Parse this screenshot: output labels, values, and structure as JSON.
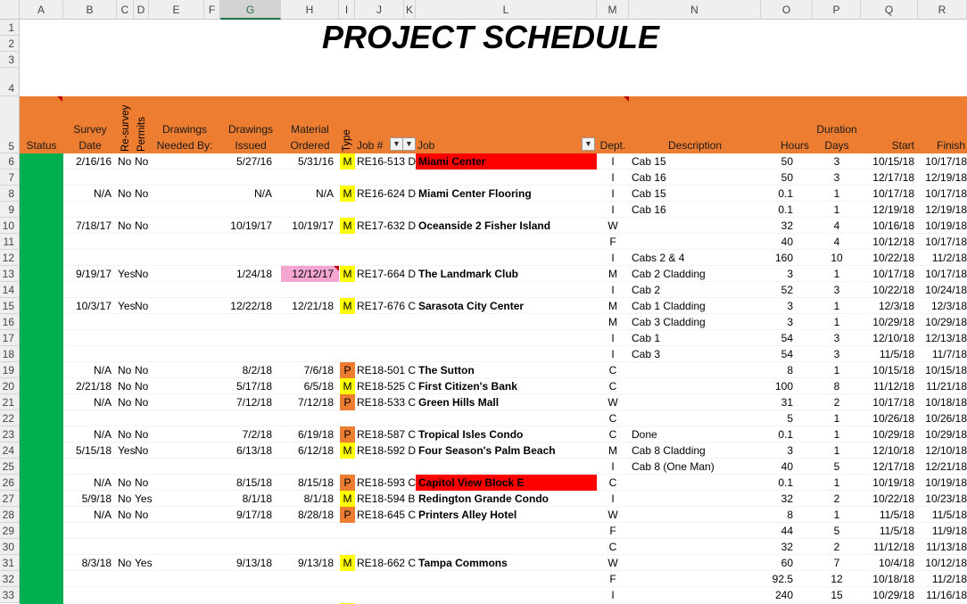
{
  "sheet": {
    "title": "PROJECT SCHEDULE",
    "columns": [
      "A",
      "B",
      "C",
      "D",
      "E",
      "F",
      "G",
      "H",
      "I",
      "J",
      "K",
      "L",
      "M",
      "N",
      "O",
      "P",
      "Q",
      "R"
    ],
    "selected_column": "G",
    "colors": {
      "header_orange": "#ed7d31",
      "status_green": "#00b050",
      "type_M": "#ffff00",
      "type_P": "#ed7d31",
      "job_highlight_red": "#ff0000",
      "material_highlight_pink": "#f4a6d0"
    },
    "headers": {
      "status": "Status",
      "survey": "Survey\nDate",
      "resurvey": "Re-survey",
      "permits": "Permits",
      "drawings_needed": "Drawings\nNeeded By:",
      "drawings_issued": "Drawings\nIssued",
      "material": "Material\nOrdered",
      "type": "Type",
      "jobnum": "Job #",
      "job": "Job",
      "dept": "Dept.",
      "description": "Description",
      "duration": "Duration",
      "hours": "Hours",
      "days": "Days",
      "start": "Start",
      "finish": "Finish"
    },
    "rows": [
      {
        "row": "6",
        "survey": "2/16/16",
        "resurvey": "No",
        "permits": "No",
        "issued": "5/27/16",
        "ordered": "5/31/16",
        "type": "M",
        "jobnum": "RE16-513 D",
        "job": "Miami Center",
        "job_red": true,
        "dept": "I",
        "desc": "Cab 15",
        "hours": "50",
        "days": "3",
        "start": "10/15/18",
        "finish": "10/17/18"
      },
      {
        "row": "7",
        "dept": "I",
        "desc": "Cab 16",
        "hours": "50",
        "days": "3",
        "start": "12/17/18",
        "finish": "12/19/18"
      },
      {
        "row": "8",
        "survey": "N/A",
        "resurvey": "No",
        "permits": "No",
        "issued": "N/A",
        "ordered": "N/A",
        "type": "M",
        "jobnum": "RE16-624 D",
        "job": "Miami Center Flooring",
        "dept": "I",
        "desc": "Cab 15",
        "hours": "0.1",
        "days": "1",
        "start": "10/17/18",
        "finish": "10/17/18"
      },
      {
        "row": "9",
        "dept": "I",
        "desc": "Cab 16",
        "hours": "0.1",
        "days": "1",
        "start": "12/19/18",
        "finish": "12/19/18"
      },
      {
        "row": "10",
        "survey": "7/18/17",
        "resurvey": "No",
        "permits": "No",
        "issued": "10/19/17",
        "ordered": "10/19/17",
        "type": "M",
        "jobnum": "RE17-632 D",
        "job": "Oceanside 2 Fisher Island",
        "dept": "W",
        "hours": "32",
        "days": "4",
        "start": "10/16/18",
        "finish": "10/19/18"
      },
      {
        "row": "11",
        "dept": "F",
        "hours": "40",
        "days": "4",
        "start": "10/12/18",
        "finish": "10/17/18"
      },
      {
        "row": "12",
        "dept": "I",
        "desc": "Cabs 2 & 4",
        "hours": "160",
        "days": "10",
        "start": "10/22/18",
        "finish": "11/2/18"
      },
      {
        "row": "13",
        "survey": "9/19/17",
        "resurvey": "Yes",
        "permits": "No",
        "issued": "1/24/18",
        "ordered": "12/12/17",
        "ordered_pink": true,
        "type": "M",
        "jobnum": "RE17-664 D",
        "job": "The Landmark Club",
        "dept": "M",
        "desc": "Cab 2 Cladding",
        "hours": "3",
        "days": "1",
        "start": "10/17/18",
        "finish": "10/17/18"
      },
      {
        "row": "14",
        "dept": "I",
        "desc": "Cab 2",
        "hours": "52",
        "days": "3",
        "start": "10/22/18",
        "finish": "10/24/18"
      },
      {
        "row": "15",
        "survey": "10/3/17",
        "resurvey": "Yes",
        "permits": "No",
        "issued": "12/22/18",
        "ordered": "12/21/18",
        "type": "M",
        "jobnum": "RE17-676 C",
        "job": "Sarasota City Center",
        "dept": "M",
        "desc": "Cab 1 Cladding",
        "hours": "3",
        "days": "1",
        "start": "12/3/18",
        "finish": "12/3/18"
      },
      {
        "row": "16",
        "dept": "M",
        "desc": "Cab 3 Cladding",
        "hours": "3",
        "days": "1",
        "start": "10/29/18",
        "finish": "10/29/18"
      },
      {
        "row": "17",
        "dept": "I",
        "desc": "Cab 1",
        "hours": "54",
        "days": "3",
        "start": "12/10/18",
        "finish": "12/13/18"
      },
      {
        "row": "18",
        "dept": "I",
        "desc": "Cab 3",
        "hours": "54",
        "days": "3",
        "start": "11/5/18",
        "finish": "11/7/18"
      },
      {
        "row": "19",
        "survey": "N/A",
        "resurvey": "No",
        "permits": "No",
        "issued": "8/2/18",
        "ordered": "7/6/18",
        "type": "P",
        "jobnum": "RE18-501 C",
        "job": "The Sutton",
        "dept": "C",
        "hours": "8",
        "days": "1",
        "start": "10/15/18",
        "finish": "10/15/18"
      },
      {
        "row": "20",
        "survey": "2/21/18",
        "resurvey": "No",
        "permits": "No",
        "issued": "5/17/18",
        "ordered": "6/5/18",
        "type": "M",
        "jobnum": "RE18-525 C",
        "job": "First Citizen's Bank",
        "dept": "C",
        "hours": "100",
        "days": "8",
        "start": "11/12/18",
        "finish": "11/21/18"
      },
      {
        "row": "21",
        "survey": "N/A",
        "resurvey": "No",
        "permits": "No",
        "issued": "7/12/18",
        "ordered": "7/12/18",
        "type": "P",
        "jobnum": "RE18-533 C",
        "job": "Green Hills Mall",
        "dept": "W",
        "hours": "31",
        "days": "2",
        "start": "10/17/18",
        "finish": "10/18/18"
      },
      {
        "row": "22",
        "dept": "C",
        "hours": "5",
        "days": "1",
        "start": "10/26/18",
        "finish": "10/26/18"
      },
      {
        "row": "23",
        "survey": "N/A",
        "resurvey": "No",
        "permits": "No",
        "issued": "7/2/18",
        "ordered": "6/19/18",
        "type": "P",
        "jobnum": "RE18-587 C",
        "job": "Tropical Isles Condo",
        "dept": "C",
        "desc": "Done",
        "hours": "0.1",
        "days": "1",
        "start": "10/29/18",
        "finish": "10/29/18"
      },
      {
        "row": "24",
        "survey": "5/15/18",
        "resurvey": "Yes",
        "permits": "No",
        "issued": "6/13/18",
        "ordered": "6/12/18",
        "type": "M",
        "jobnum": "RE18-592 D",
        "job": "Four Season's Palm Beach",
        "dept": "M",
        "desc": "Cab 8 Cladding",
        "hours": "3",
        "days": "1",
        "start": "12/10/18",
        "finish": "12/10/18"
      },
      {
        "row": "25",
        "dept": "I",
        "desc": "Cab 8 (One Man)",
        "hours": "40",
        "days": "5",
        "start": "12/17/18",
        "finish": "12/21/18"
      },
      {
        "row": "26",
        "survey": "N/A",
        "resurvey": "No",
        "permits": "No",
        "issued": "8/15/18",
        "ordered": "8/15/18",
        "type": "P",
        "jobnum": "RE18-593 C",
        "job": "Capitol View Block E",
        "job_red": true,
        "dept": "C",
        "hours": "0.1",
        "days": "1",
        "start": "10/19/18",
        "finish": "10/19/18"
      },
      {
        "row": "27",
        "survey": "5/9/18",
        "resurvey": "No",
        "permits": "Yes",
        "issued": "8/1/18",
        "ordered": "8/1/18",
        "type": "M",
        "jobnum": "RE18-594 B",
        "job": "Redington Grande Condo",
        "dept": "I",
        "hours": "32",
        "days": "2",
        "start": "10/22/18",
        "finish": "10/23/18"
      },
      {
        "row": "28",
        "survey": "N/A",
        "resurvey": "No",
        "permits": "No",
        "issued": "9/17/18",
        "ordered": "8/28/18",
        "type": "P",
        "jobnum": "RE18-645 C",
        "job": "Printers Alley Hotel",
        "dept": "W",
        "hours": "8",
        "days": "1",
        "start": "11/5/18",
        "finish": "11/5/18"
      },
      {
        "row": "29",
        "dept": "F",
        "hours": "44",
        "days": "5",
        "start": "11/5/18",
        "finish": "11/9/18"
      },
      {
        "row": "30",
        "dept": "C",
        "hours": "32",
        "days": "2",
        "start": "11/12/18",
        "finish": "11/13/18"
      },
      {
        "row": "31",
        "survey": "8/3/18",
        "resurvey": "No",
        "permits": "Yes",
        "issued": "9/13/18",
        "ordered": "9/13/18",
        "type": "M",
        "jobnum": "RE18-662 C",
        "job": "Tampa Commons",
        "dept": "W",
        "hours": "60",
        "days": "7",
        "start": "10/4/18",
        "finish": "10/12/18"
      },
      {
        "row": "32",
        "dept": "F",
        "hours": "92.5",
        "days": "12",
        "start": "10/18/18",
        "finish": "11/2/18"
      },
      {
        "row": "33",
        "dept": "I",
        "hours": "240",
        "days": "15",
        "start": "10/29/18",
        "finish": "11/16/18"
      }
    ]
  }
}
